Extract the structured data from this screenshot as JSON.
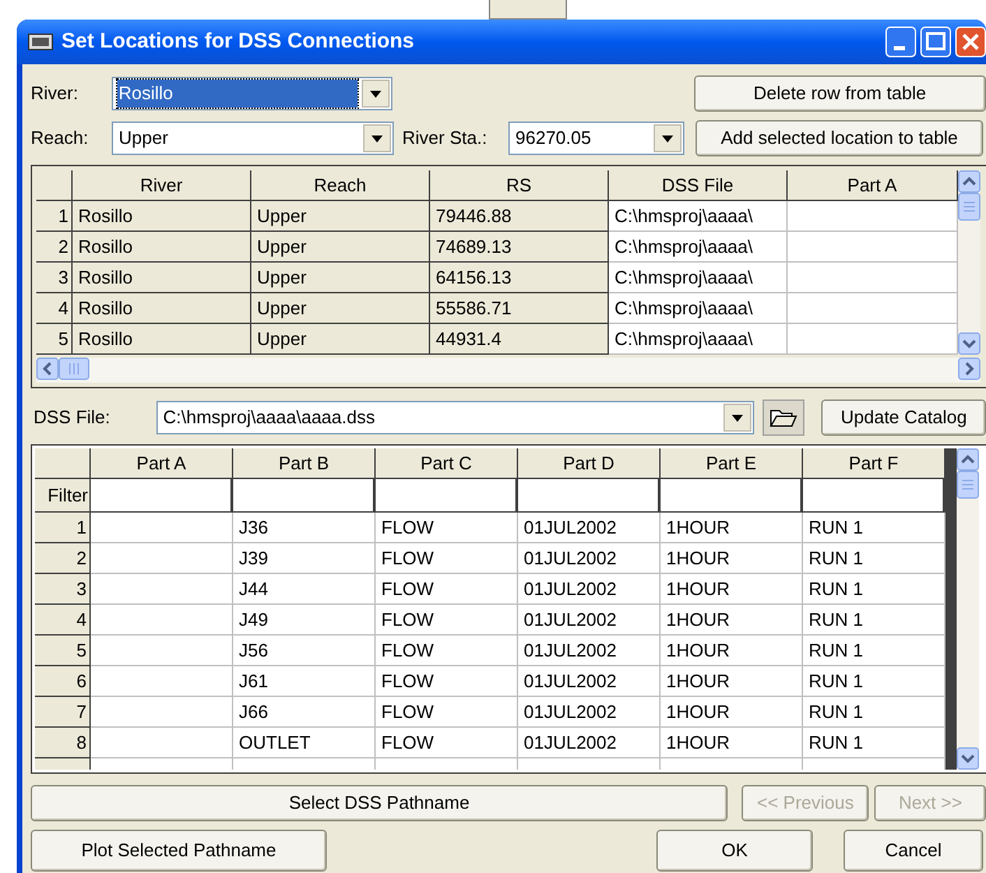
{
  "window": {
    "title": "Set Locations for DSS Connections"
  },
  "river": {
    "label": "River:",
    "value": "Rosillo",
    "highlighted": true
  },
  "reach": {
    "label": "Reach:",
    "value": "Upper",
    "highlighted": false
  },
  "river_sta": {
    "label": "River Sta.:",
    "value": "96270.05",
    "highlighted": false
  },
  "top_buttons": [
    {
      "label": "Delete row from table"
    },
    {
      "label": "Add selected location to table"
    }
  ],
  "locations_table": {
    "columns": [
      {
        "label": "River",
        "editable": false
      },
      {
        "label": "Reach",
        "editable": false
      },
      {
        "label": "RS",
        "editable": false
      },
      {
        "label": "DSS File",
        "editable": true
      },
      {
        "label": "Part A",
        "editable": true
      }
    ],
    "rows": [
      {
        "number": "1",
        "cells": [
          "Rosillo",
          "Upper",
          "79446.88",
          "C:\\hmsproj\\aaaa\\",
          ""
        ]
      },
      {
        "number": "2",
        "cells": [
          "Rosillo",
          "Upper",
          "74689.13",
          "C:\\hmsproj\\aaaa\\",
          ""
        ]
      },
      {
        "number": "3",
        "cells": [
          "Rosillo",
          "Upper",
          "64156.13",
          "C:\\hmsproj\\aaaa\\",
          ""
        ]
      },
      {
        "number": "4",
        "cells": [
          "Rosillo",
          "Upper",
          "55586.71",
          "C:\\hmsproj\\aaaa\\",
          ""
        ]
      },
      {
        "number": "5",
        "cells": [
          "Rosillo",
          "Upper",
          "44931.4",
          "C:\\hmsproj\\aaaa\\",
          ""
        ]
      }
    ]
  },
  "dss_file": {
    "label": "DSS File:",
    "value": "C:\\hmsproj\\aaaa\\aaaa.dss"
  },
  "update_button": {
    "label": "Update Catalog"
  },
  "catalog_table": {
    "columns": [
      "Part A",
      "Part B",
      "Part C",
      "Part D",
      "Part E",
      "Part F"
    ],
    "filter_label": "Filter",
    "rows": [
      {
        "number": "1",
        "cells": [
          "",
          "J36",
          "FLOW",
          "01JUL2002",
          "1HOUR",
          "RUN 1"
        ]
      },
      {
        "number": "2",
        "cells": [
          "",
          "J39",
          "FLOW",
          "01JUL2002",
          "1HOUR",
          "RUN 1"
        ]
      },
      {
        "number": "3",
        "cells": [
          "",
          "J44",
          "FLOW",
          "01JUL2002",
          "1HOUR",
          "RUN 1"
        ]
      },
      {
        "number": "4",
        "cells": [
          "",
          "J49",
          "FLOW",
          "01JUL2002",
          "1HOUR",
          "RUN 1"
        ]
      },
      {
        "number": "5",
        "cells": [
          "",
          "J56",
          "FLOW",
          "01JUL2002",
          "1HOUR",
          "RUN 1"
        ]
      },
      {
        "number": "6",
        "cells": [
          "",
          "J61",
          "FLOW",
          "01JUL2002",
          "1HOUR",
          "RUN 1"
        ]
      },
      {
        "number": "7",
        "cells": [
          "",
          "J66",
          "FLOW",
          "01JUL2002",
          "1HOUR",
          "RUN 1"
        ]
      },
      {
        "number": "8",
        "cells": [
          "",
          "OUTLET",
          "FLOW",
          "01JUL2002",
          "1HOUR",
          "RUN 1"
        ]
      }
    ]
  },
  "select_button": {
    "label": "Select DSS Pathname"
  },
  "nav_buttons": [
    {
      "label": "<< Previous",
      "disabled": true
    },
    {
      "label": "Next >>",
      "disabled": true
    }
  ],
  "bottom_buttons": [
    {
      "label": "Plot Selected Pathname"
    },
    {
      "label": "OK"
    },
    {
      "label": "Cancel"
    }
  ]
}
